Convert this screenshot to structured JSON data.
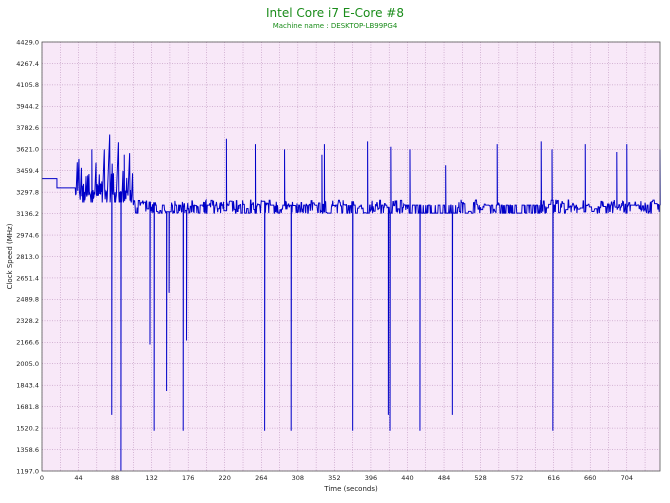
{
  "chart_data": {
    "type": "line",
    "title": "Intel Core i7 E-Core #8",
    "subtitle": "Machine name : DESKTOP-LB99PG4",
    "xlabel": "Time (seconds)",
    "ylabel": "Clock Speed (MHz)",
    "xlim": [
      0,
      744
    ],
    "ylim": [
      1197.0,
      4429.0
    ],
    "xticks": [
      0,
      44,
      88,
      132,
      176,
      220,
      264,
      308,
      352,
      396,
      440,
      484,
      528,
      572,
      616,
      660,
      704
    ],
    "yticks": [
      "1197.0",
      "1358.6",
      "1520.2",
      "1681.8",
      "1843.4",
      "2005.0",
      "2166.6",
      "2328.2",
      "2489.8",
      "2651.4",
      "2813.0",
      "2974.6",
      "3136.2",
      "3297.8",
      "3459.4",
      "3621.0",
      "3782.6",
      "3944.2",
      "4105.8",
      "4267.4",
      "4429.0"
    ],
    "grid": true,
    "colors": {
      "plot_bg": "#f8e8f8",
      "grid": "#b080b0",
      "line": "#0000c8",
      "title": "#1a8c1a"
    },
    "series": [
      {
        "name": "",
        "baseline_mhz": 3200,
        "start": {
          "x": [
            0,
            18,
            18,
            40
          ],
          "y": [
            3400,
            3400,
            3330,
            3330
          ]
        },
        "spikes_up_mhz": [
          [
            37,
            3660
          ],
          [
            40,
            3640
          ],
          [
            60,
            3620
          ],
          [
            84,
            3660
          ],
          [
            99,
            3580
          ],
          [
            222,
            3700
          ],
          [
            257,
            3660
          ],
          [
            292,
            3620
          ],
          [
            337,
            3580
          ],
          [
            340,
            3660
          ],
          [
            392,
            3680
          ],
          [
            420,
            3640
          ],
          [
            443,
            3620
          ],
          [
            486,
            3500
          ],
          [
            548,
            3660
          ],
          [
            601,
            3680
          ],
          [
            614,
            3620
          ],
          [
            654,
            3660
          ],
          [
            692,
            3600
          ],
          [
            704,
            3660
          ],
          [
            744,
            3620
          ]
        ],
        "spikes_down_mhz": [
          [
            84,
            1620
          ],
          [
            95,
            1200
          ],
          [
            130,
            2150
          ],
          [
            135,
            1500
          ],
          [
            150,
            1800
          ],
          [
            153,
            2540
          ],
          [
            170,
            1500
          ],
          [
            174,
            2180
          ],
          [
            268,
            1500
          ],
          [
            300,
            1500
          ],
          [
            374,
            1500
          ],
          [
            417,
            1620
          ],
          [
            419,
            1500
          ],
          [
            455,
            1500
          ],
          [
            494,
            1620
          ],
          [
            615,
            1500
          ]
        ]
      }
    ]
  }
}
